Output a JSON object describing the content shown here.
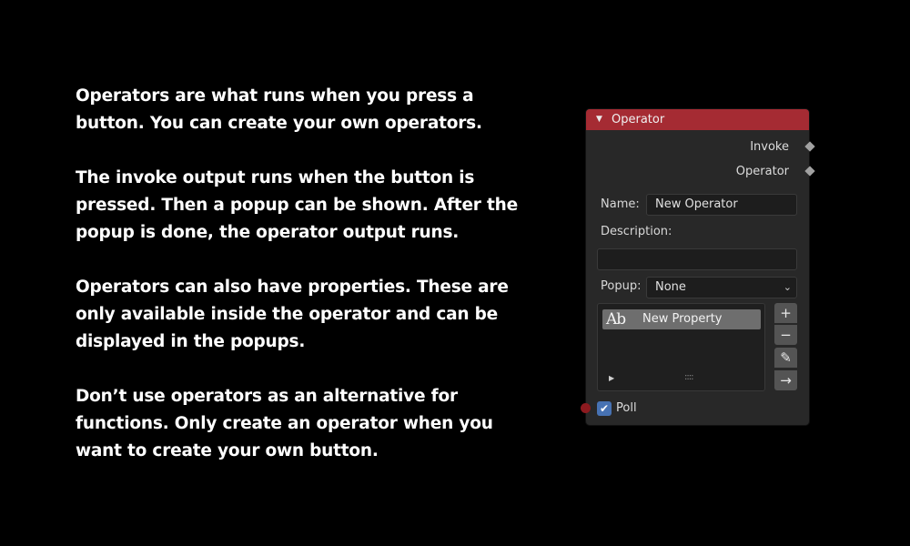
{
  "paragraphs": [
    "Operators are what runs when you press a button. You can create your own operators.",
    "The invoke output runs when the button is pressed. Then a popup can be shown. After the popup is done, the operator output runs.",
    "Operators can also have properties. These are only available inside the operator and can be displayed in the popups.",
    "Don’t use operators as an alternative for functions. Only create an operator when you want to create your own button."
  ],
  "node": {
    "title": "Operator",
    "header_color": "#a52b33",
    "outputs": {
      "invoke": "Invoke",
      "operator": "Operator"
    },
    "name_label": "Name:",
    "name_value": "New Operator",
    "description_label": "Description:",
    "description_value": "",
    "popup_label": "Popup:",
    "popup_value": "None",
    "properties": [
      {
        "icon": "string-property-icon",
        "icon_text": "Ab",
        "label": "New Property"
      }
    ],
    "side_buttons": [
      "plus-icon",
      "minus-icon",
      "pencil-icon",
      "arrow-right-icon"
    ],
    "poll_label": "Poll",
    "poll_checked": true
  }
}
